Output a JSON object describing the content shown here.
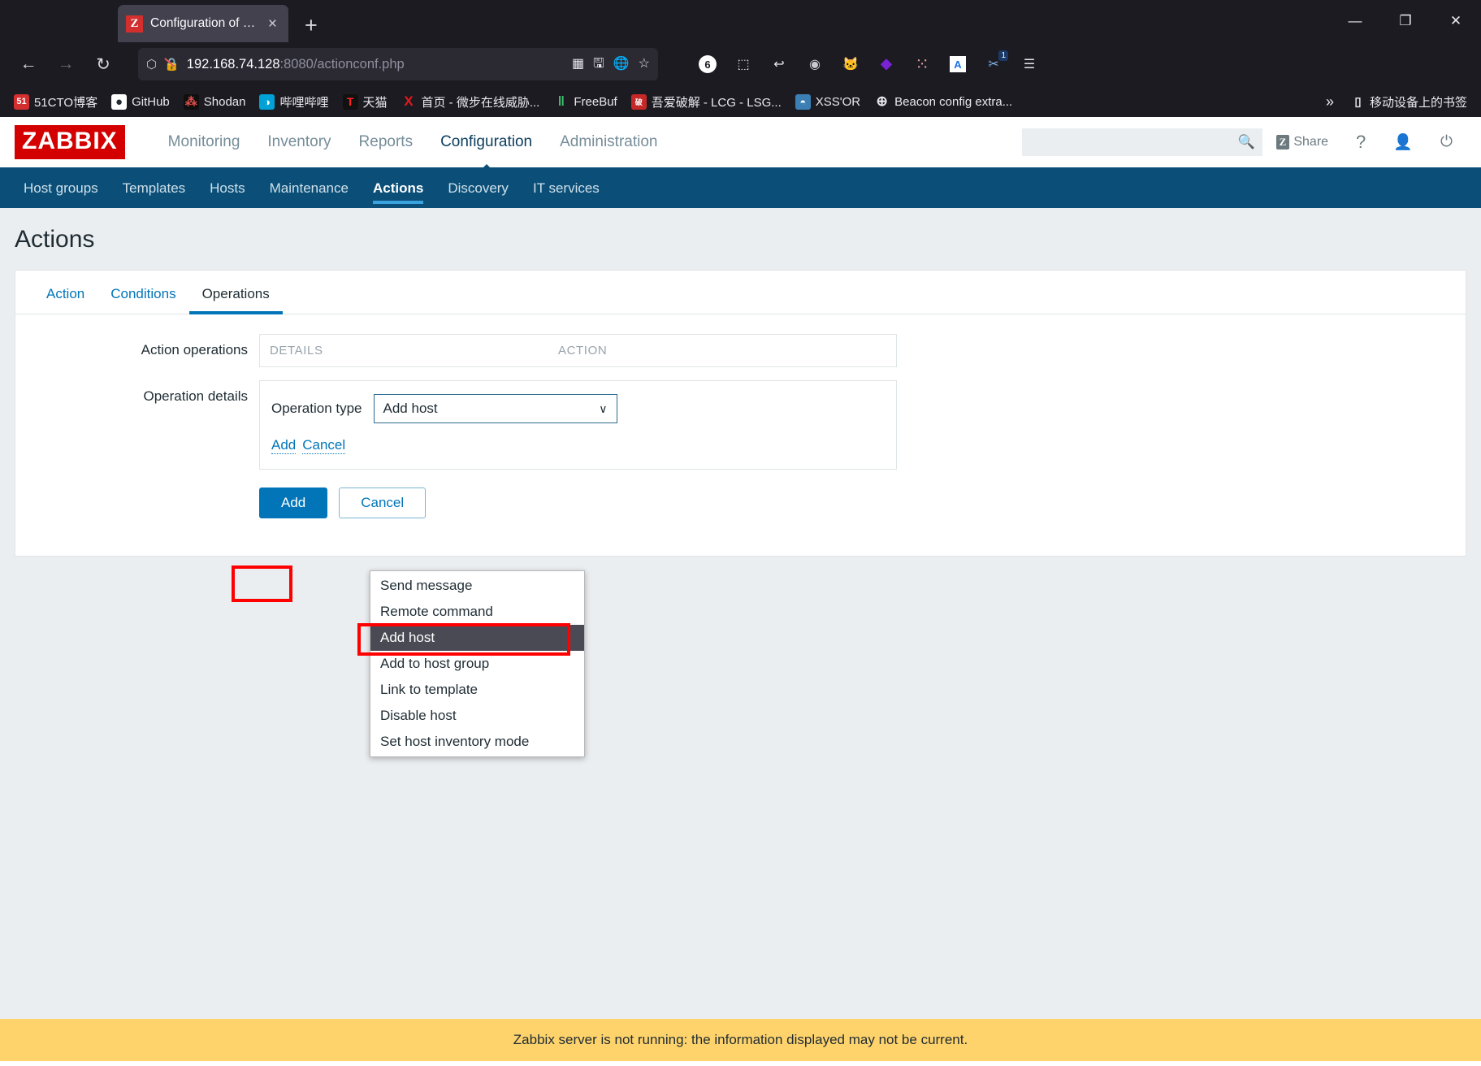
{
  "browser": {
    "tab": {
      "title": "Configuration of actions",
      "favicon_letter": "Z",
      "close_label": "×"
    },
    "new_tab_label": "+",
    "window_controls": {
      "minimize": "—",
      "maximize": "❐",
      "close": "✕"
    },
    "nav": {
      "back": "←",
      "forward": "→",
      "reload": "↻"
    },
    "url": {
      "host": "192.168.74.128",
      "rest": ":8080/actionconf.php",
      "shield_icon": "shield-icon",
      "lock_broken_icon": "lock-broken-icon"
    },
    "urlbox_icons": [
      "qr-code-icon",
      "save-to-device-icon",
      "translate-icon",
      "bookmark-star-icon"
    ],
    "extension_icons": [
      {
        "name": "counter-badge-icon",
        "glyph": "6"
      },
      {
        "name": "crop-icon",
        "glyph": "⬚"
      },
      {
        "name": "undo-arrow-icon",
        "glyph": "↩"
      },
      {
        "name": "circle-record-icon",
        "glyph": "◉"
      },
      {
        "name": "cat-extension-icon",
        "glyph": "🐱"
      },
      {
        "name": "purple-cube-icon",
        "glyph": "⬥"
      },
      {
        "name": "blur-dots-icon",
        "glyph": "⁙"
      },
      {
        "name": "translate-extension-icon",
        "glyph": "A"
      },
      {
        "name": "scissors-extension-icon",
        "glyph": "✂",
        "badge": "1"
      },
      {
        "name": "app-menu-icon",
        "glyph": "☰"
      }
    ],
    "bookmarks": [
      {
        "label": "51CTO博客",
        "icon": "51cto-icon",
        "glyph": "51",
        "bg": "#d32f2f"
      },
      {
        "label": "GitHub",
        "icon": "github-icon",
        "glyph": "●",
        "bg": "#2b2a33"
      },
      {
        "label": "Shodan",
        "icon": "shodan-icon",
        "glyph": "⁂",
        "bg": "#111111"
      },
      {
        "label": "哔哩哔哩",
        "icon": "bilibili-icon",
        "glyph": "◑",
        "bg": "#00a1d6"
      },
      {
        "label": "天猫",
        "icon": "tmall-icon",
        "glyph": "T",
        "bg": "#111111"
      },
      {
        "label": "首页 - 微步在线威胁...",
        "icon": "threatbook-icon",
        "glyph": "X",
        "bg": "transparent"
      },
      {
        "label": "FreeBuf",
        "icon": "freebuf-icon",
        "glyph": "‖",
        "bg": "transparent"
      },
      {
        "label": "吾爱破解 - LCG - LSG...",
        "icon": "52pojie-icon",
        "glyph": "破",
        "bg": "#c62828"
      },
      {
        "label": "XSS'OR",
        "icon": "xssor-icon",
        "glyph": "◓",
        "bg": "#3b7fb5"
      },
      {
        "label": "Beacon config extra...",
        "icon": "globe-icon",
        "glyph": "⊕",
        "bg": "transparent"
      }
    ],
    "bookmarks_overflow": "»",
    "mobile_bookmarks": {
      "label": "移动设备上的书签",
      "icon": "mobile-device-icon",
      "glyph": "▯"
    }
  },
  "zabbix": {
    "logo": "ZABBIX",
    "main_nav": [
      {
        "label": "Monitoring",
        "active": false
      },
      {
        "label": "Inventory",
        "active": false
      },
      {
        "label": "Reports",
        "active": false
      },
      {
        "label": "Configuration",
        "active": true
      },
      {
        "label": "Administration",
        "active": false
      }
    ],
    "search": {
      "value": "",
      "placeholder": "",
      "icon": "search-icon"
    },
    "header_actions": {
      "share_label": "Share",
      "share_badge": "Z",
      "help_label": "?",
      "user_icon": "user-icon",
      "signout_icon": "power-icon"
    },
    "sub_nav": [
      {
        "label": "Host groups",
        "active": false
      },
      {
        "label": "Templates",
        "active": false
      },
      {
        "label": "Hosts",
        "active": false
      },
      {
        "label": "Maintenance",
        "active": false
      },
      {
        "label": "Actions",
        "active": true
      },
      {
        "label": "Discovery",
        "active": false
      },
      {
        "label": "IT services",
        "active": false
      }
    ],
    "page_title": "Actions",
    "tabs": [
      {
        "label": "Action",
        "active": false
      },
      {
        "label": "Conditions",
        "active": false
      },
      {
        "label": "Operations",
        "active": true
      }
    ],
    "form": {
      "action_operations": {
        "label": "Action operations",
        "columns": [
          "DETAILS",
          "ACTION"
        ],
        "rows": []
      },
      "operation_details": {
        "label": "Operation details",
        "operation_type_label": "Operation type",
        "operation_type_value": "Add host",
        "chevron": "∨",
        "inline_add": "Add",
        "inline_cancel": "Cancel"
      },
      "buttons": [
        {
          "label": "Add",
          "style": "primary"
        },
        {
          "label": "Cancel",
          "style": "secondary"
        }
      ]
    },
    "dropdown": {
      "open": true,
      "options": [
        {
          "label": "Send message",
          "selected": false
        },
        {
          "label": "Remote command",
          "selected": false
        },
        {
          "label": "Add host",
          "selected": true
        },
        {
          "label": "Add to host group",
          "selected": false
        },
        {
          "label": "Link to template",
          "selected": false
        },
        {
          "label": "Disable host",
          "selected": false
        },
        {
          "label": "Set host inventory mode",
          "selected": false
        }
      ]
    },
    "footer_message": "Zabbix server is not running: the information displayed may not be current."
  },
  "annotations": {
    "highlight_color": "#ff0000",
    "boxes": [
      "add-link-highlight",
      "dropdown-add-host-highlight"
    ]
  }
}
